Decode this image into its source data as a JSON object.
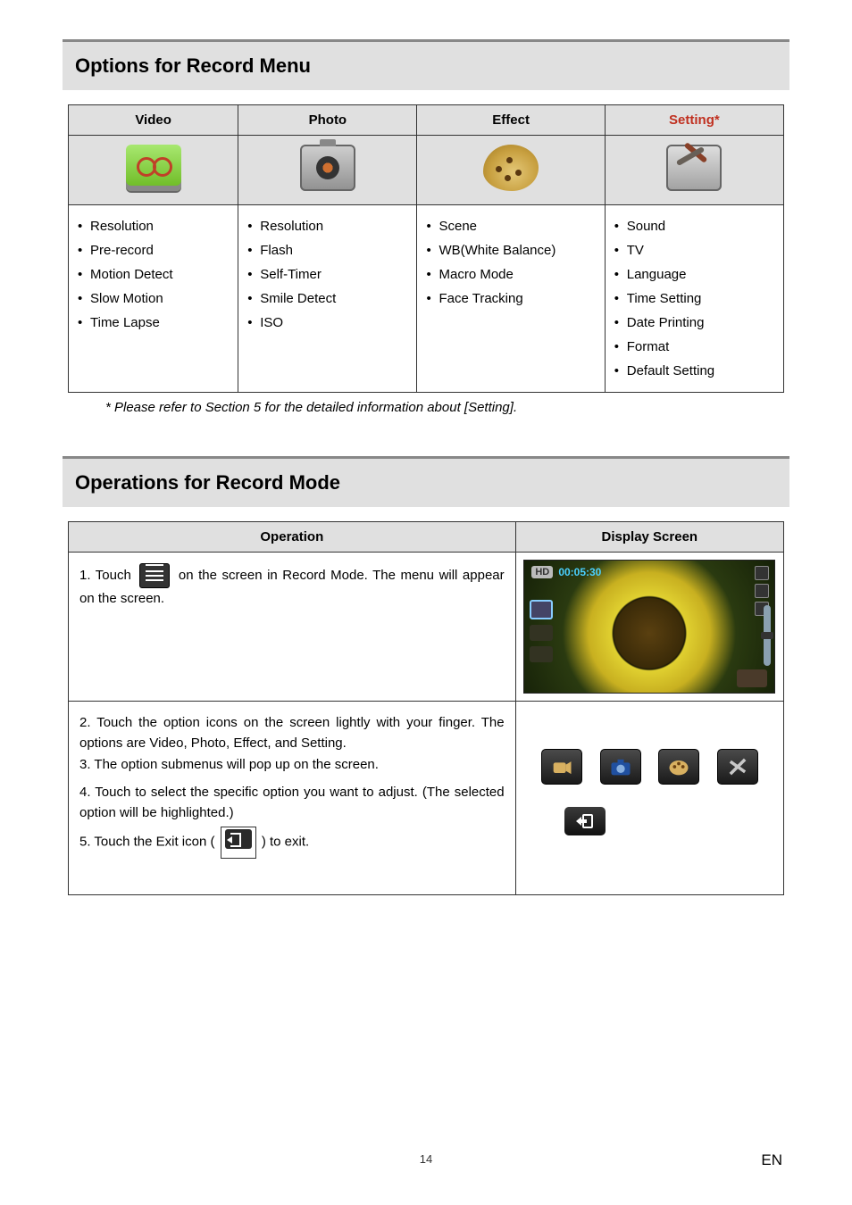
{
  "sections": {
    "options_title": "Options for Record Menu",
    "operations_title": "Operations for Record Mode"
  },
  "options_table": {
    "headers": {
      "video": "Video",
      "photo": "Photo",
      "effect": "Effect",
      "setting": "Setting*"
    },
    "video_items": [
      "Resolution",
      "Pre-record",
      "Motion Detect",
      "Slow Motion",
      "Time Lapse"
    ],
    "photo_items": [
      "Resolution",
      "Flash",
      "Self-Timer",
      "Smile Detect",
      "ISO"
    ],
    "effect_items": [
      "Scene",
      "WB(White Balance)",
      "Macro Mode",
      "Face Tracking"
    ],
    "setting_items": [
      "Sound",
      "TV",
      "Language",
      "Time Setting",
      "Date Printing",
      "Format",
      "Default Setting"
    ]
  },
  "note": "* Please refer to Section 5 for the detailed information about [Setting].",
  "ops_table": {
    "headers": {
      "operation": "Operation",
      "display": "Display Screen"
    },
    "row1": {
      "prefix": "1. Touch",
      "mid": "on the screen in Record Mode. The menu",
      "tail": "will appear on the screen."
    },
    "row2": {
      "s2": "2. Touch the option icons on the screen lightly with your finger. The options are Video, Photo, Effect, and Setting.",
      "s3": "3. The option submenus will pop up on the screen.",
      "s4": "4. Touch to select the specific option you want to adjust. (The selected option will be highlighted.)",
      "s5a": "5. Touch the Exit icon (",
      "s5b": ") to exit."
    },
    "screenshot": {
      "badge": "HD",
      "time": "00:05:30"
    }
  },
  "footer": {
    "page": "14",
    "lang": "EN"
  }
}
